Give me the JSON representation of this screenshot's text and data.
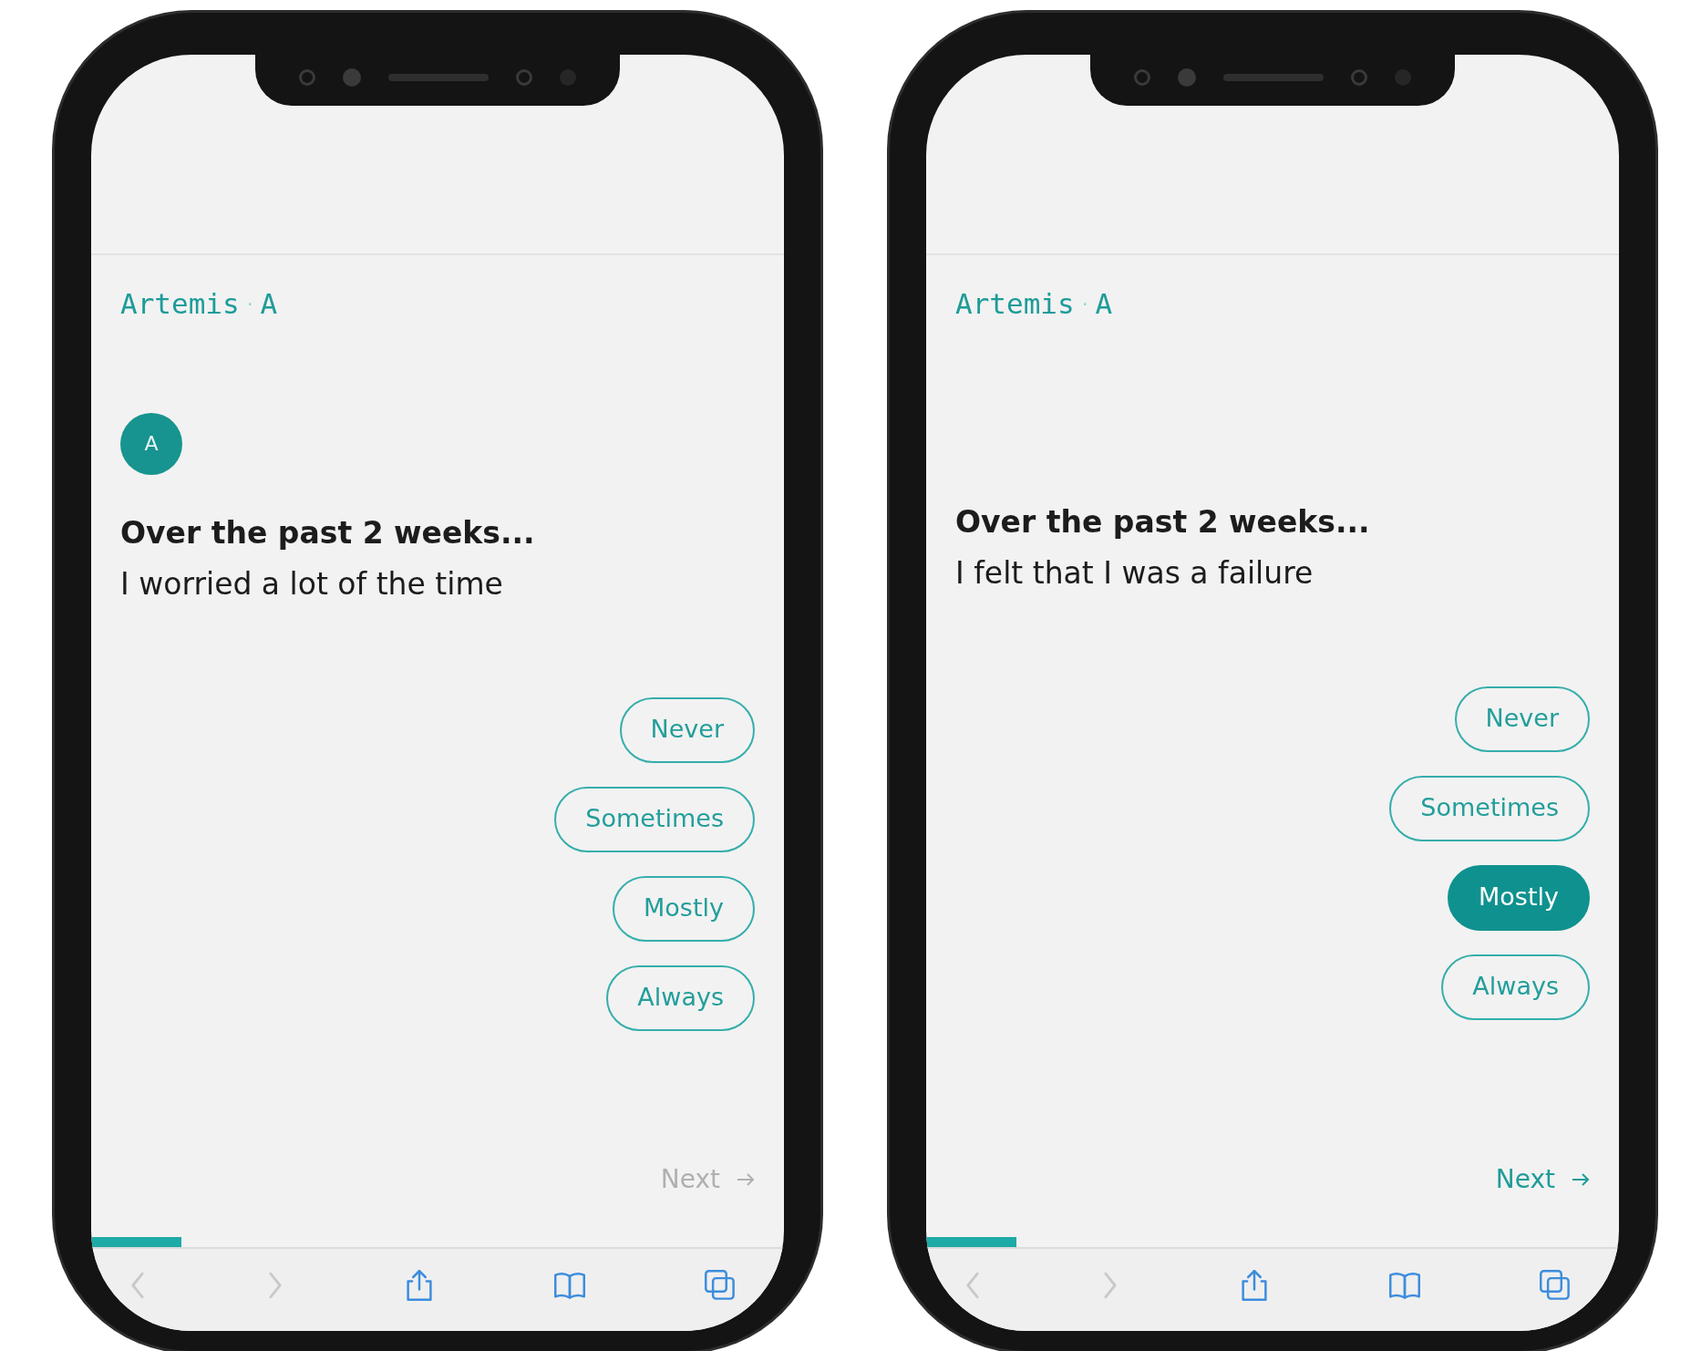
{
  "phones": [
    {
      "brand": {
        "name": "Artemis",
        "separator": "·",
        "initial": "A"
      },
      "avatar": {
        "initial": "A"
      },
      "question": {
        "lead": "Over the past 2 weeks...",
        "statement": "I worried a lot of the time"
      },
      "options": [
        {
          "label": "Never",
          "selected": false
        },
        {
          "label": "Sometimes",
          "selected": false
        },
        {
          "label": "Mostly",
          "selected": false
        },
        {
          "label": "Always",
          "selected": false
        }
      ],
      "next": {
        "label": "Next",
        "disabled": true
      },
      "progress": {
        "level": 0.13
      },
      "toolbar": [
        {
          "kind": "back",
          "disabled": true
        },
        {
          "kind": "forward",
          "disabled": true
        },
        {
          "kind": "share",
          "disabled": false
        },
        {
          "kind": "bookmarks",
          "disabled": false
        },
        {
          "kind": "tabs",
          "disabled": false
        }
      ]
    },
    {
      "brand": {
        "name": "Artemis",
        "separator": "·",
        "initial": "A"
      },
      "question": {
        "lead": "Over the past 2 weeks...",
        "statement": "I felt that I was a failure"
      },
      "options": [
        {
          "label": "Never",
          "selected": false
        },
        {
          "label": "Sometimes",
          "selected": false
        },
        {
          "label": "Mostly",
          "selected": true
        },
        {
          "label": "Always",
          "selected": false
        }
      ],
      "next": {
        "label": "Next",
        "disabled": false
      },
      "progress": {
        "level": 0.13
      },
      "toolbar": [
        {
          "kind": "back",
          "disabled": true
        },
        {
          "kind": "forward",
          "disabled": true
        },
        {
          "kind": "share",
          "disabled": false
        },
        {
          "kind": "bookmarks",
          "disabled": false
        },
        {
          "kind": "tabs",
          "disabled": false
        }
      ]
    }
  ]
}
